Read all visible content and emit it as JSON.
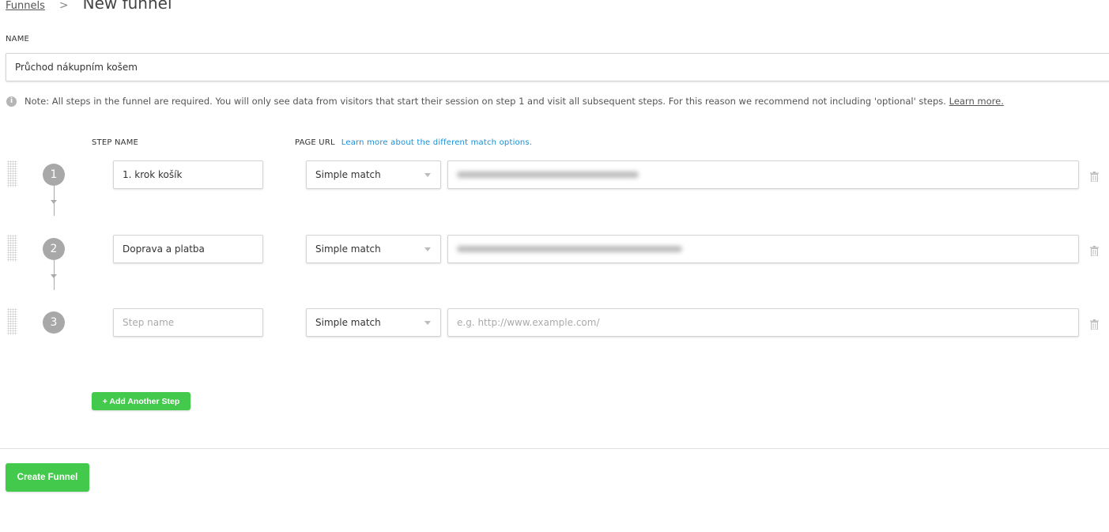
{
  "breadcrumb": {
    "parent": "Funnels",
    "current": "New funnel"
  },
  "name_field": {
    "label": "NAME",
    "value": "Průchod nákupním košem"
  },
  "note": {
    "text": "Note: All steps in the funnel are required. You will only see data from visitors that start their session on step 1 and visit all subsequent steps. For this reason we recommend not including 'optional' steps.",
    "link": "Learn more."
  },
  "headers": {
    "step_name": "STEP NAME",
    "page_url": "PAGE URL",
    "match_link": "Learn more about the different match options."
  },
  "steps": [
    {
      "number": "1",
      "name": "1. krok košík",
      "match": "Simple match"
    },
    {
      "number": "2",
      "name": "Doprava a platba",
      "match": "Simple match"
    },
    {
      "number": "3",
      "name": "",
      "name_placeholder": "Step name",
      "match": "Simple match",
      "url_placeholder": "e.g. http://www.example.com/"
    }
  ],
  "add_step_label": "+ Add Another Step",
  "create_label": "Create Funnel",
  "colors": {
    "accent_green": "#43c94c",
    "link_blue": "#1a8fd6",
    "step_circle": "#a8a8a8"
  }
}
